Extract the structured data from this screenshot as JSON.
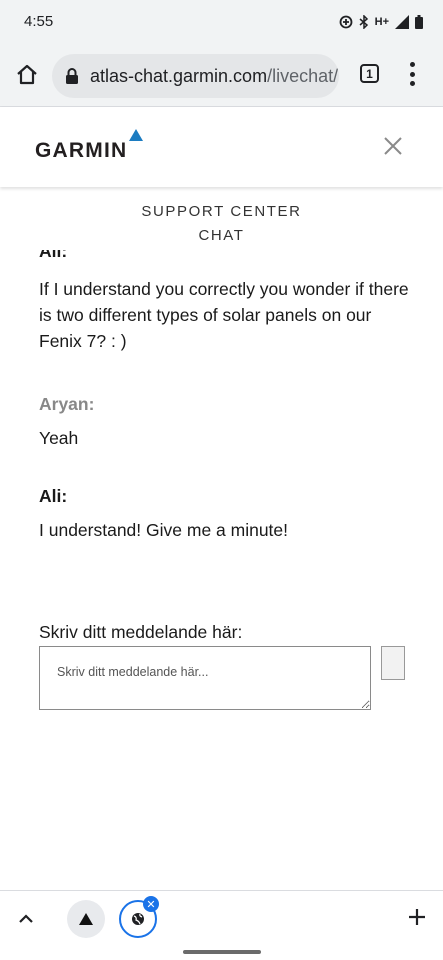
{
  "status_bar": {
    "time": "4:55",
    "network": "H+"
  },
  "browser": {
    "url_domain": "atlas-chat.garmin.com",
    "url_path": "/livechat/",
    "tab_count": "1"
  },
  "site": {
    "logo_text": "GARMIN"
  },
  "chat": {
    "title_line1": "SUPPORT CENTER",
    "title_line2": "CHAT",
    "messages": [
      {
        "sender": "Ali:",
        "text": "If I understand you correctly you wonder if there is two different types of solar panels on our Fenix 7? : )"
      },
      {
        "sender": "Aryan:",
        "text": "Yeah"
      },
      {
        "sender": "Ali:",
        "text": "I understand! Give me a minute!"
      }
    ]
  },
  "composer": {
    "label": "Skriv ditt meddelande här:",
    "placeholder": "Skriv ditt meddelande här..."
  },
  "colors": {
    "garmin_blue": "#1c7cc1",
    "chrome_blue": "#1a73e8",
    "toolbar_bg": "#f1f3f4"
  },
  "icons": {
    "home": "home-icon",
    "lock": "lock-icon",
    "menu": "more-vert-icon",
    "close": "close-icon",
    "up": "chevron-up-icon",
    "plus": "plus-icon",
    "globe": "globe-icon"
  }
}
